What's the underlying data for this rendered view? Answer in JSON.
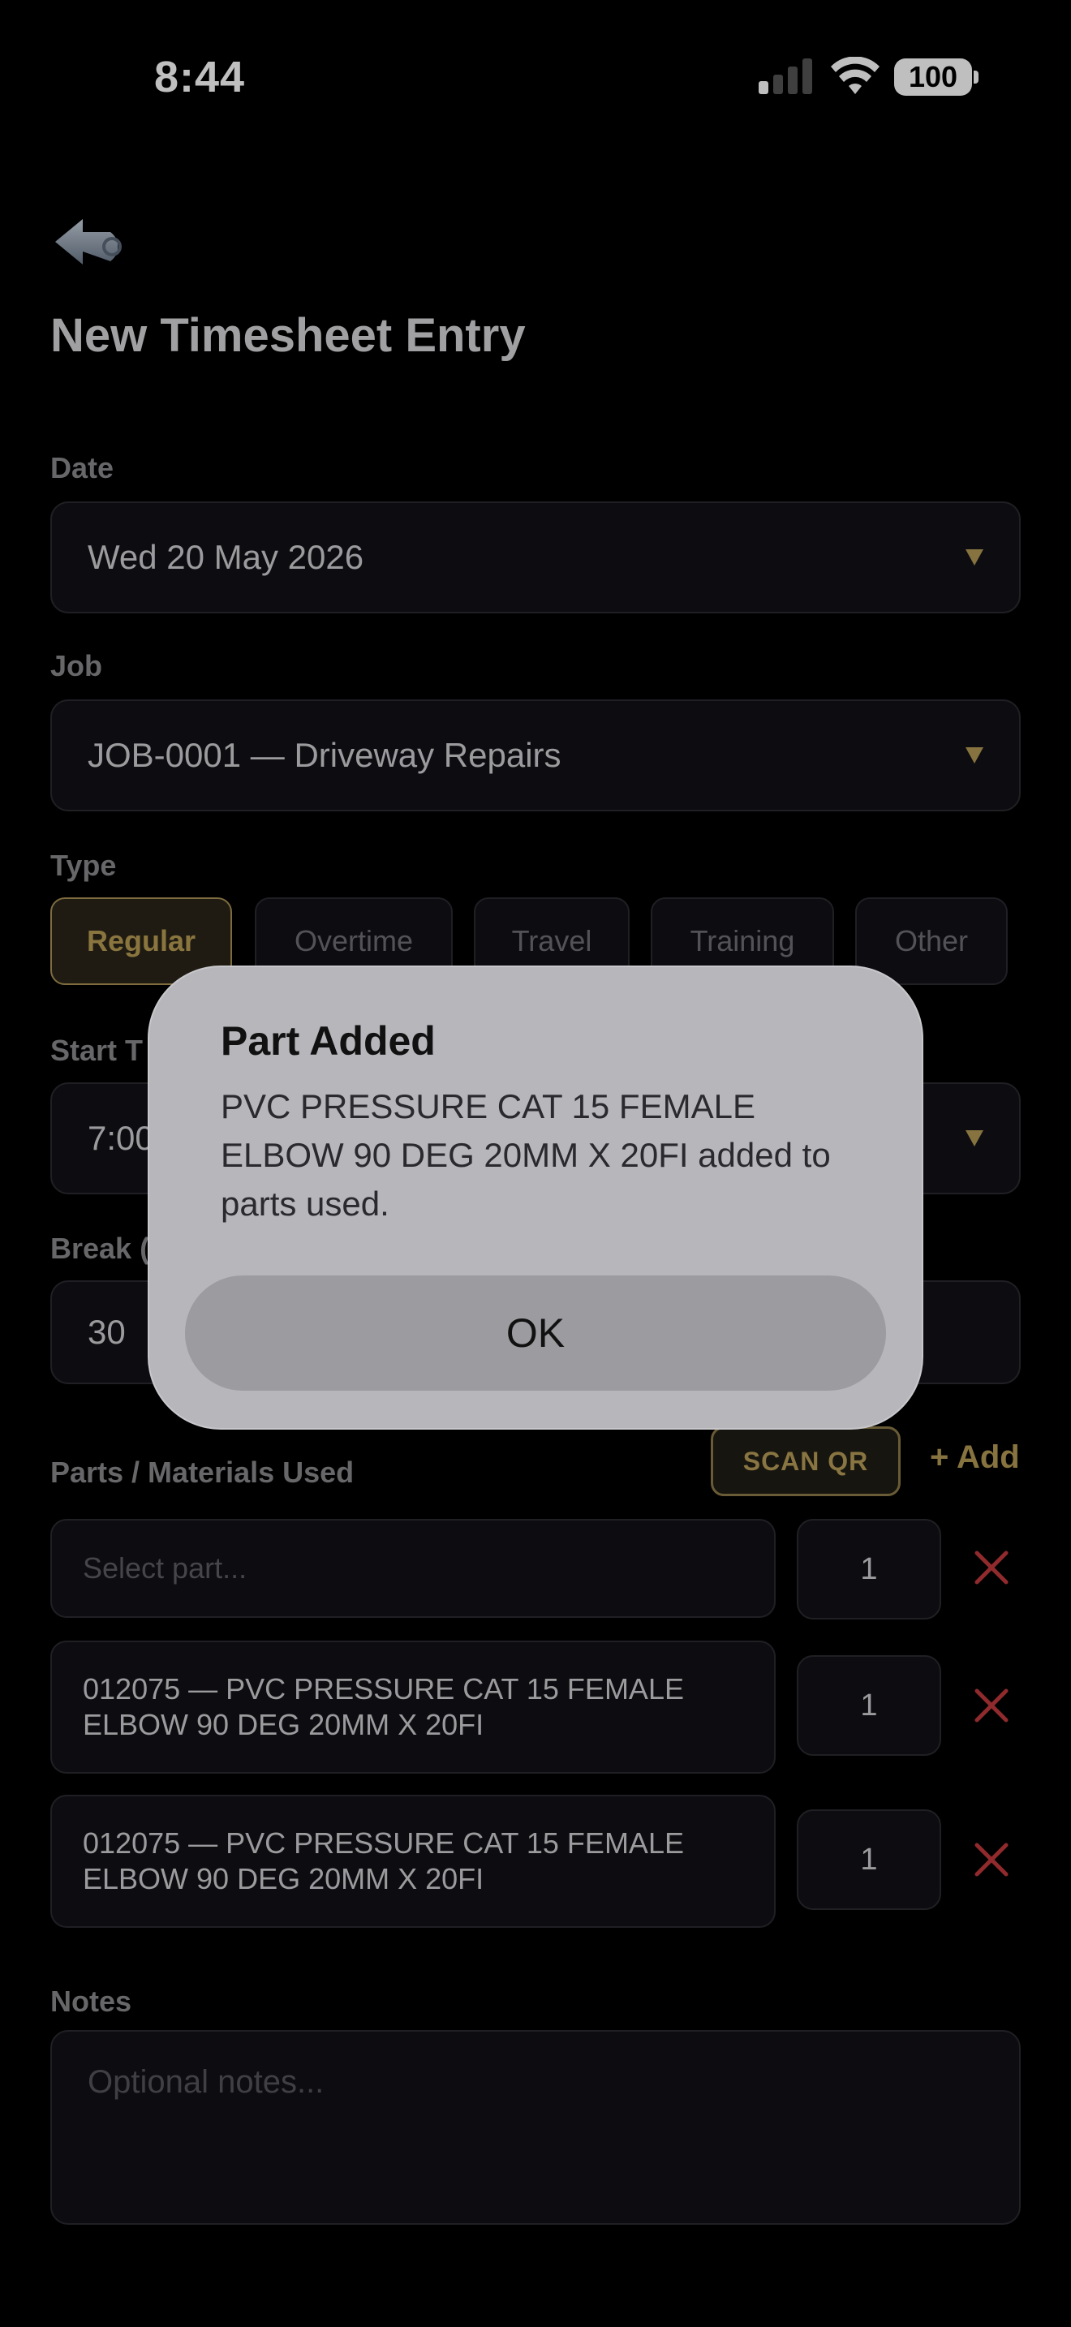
{
  "status_bar": {
    "time": "8:44",
    "battery": "100"
  },
  "header": {
    "title": "New Timesheet Entry"
  },
  "date": {
    "label": "Date",
    "value": "Wed 20 May 2026"
  },
  "job": {
    "label": "Job",
    "value": "JOB-0001 — Driveway Repairs"
  },
  "type": {
    "label": "Type",
    "options": [
      "Regular",
      "Overtime",
      "Travel",
      "Training",
      "Other"
    ],
    "selected": "Regular"
  },
  "start_time": {
    "label": "Start T",
    "value": "7:00"
  },
  "break": {
    "label": "Break (",
    "value": "30"
  },
  "parts": {
    "label": "Parts / Materials Used",
    "scan_label": "SCAN QR",
    "add_label": "+ Add",
    "select_placeholder": "Select part...",
    "rows": [
      {
        "part": "",
        "qty": "1"
      },
      {
        "part": "012075 — PVC PRESSURE CAT 15 FEMALE ELBOW 90 DEG 20MM X 20FI",
        "qty": "1"
      },
      {
        "part": "012075 — PVC PRESSURE CAT 15 FEMALE ELBOW 90 DEG 20MM X 20FI",
        "qty": "1"
      }
    ]
  },
  "notes": {
    "label": "Notes",
    "placeholder": "Optional notes..."
  },
  "alert": {
    "title": "Part Added",
    "message": "PVC PRESSURE CAT 15 FEMALE ELBOW 90 DEG 20MM X 20FI added to parts used.",
    "ok_label": "OK"
  },
  "colors": {
    "accent": "#b39a55",
    "remove": "#c0393b",
    "background": "#000000"
  }
}
